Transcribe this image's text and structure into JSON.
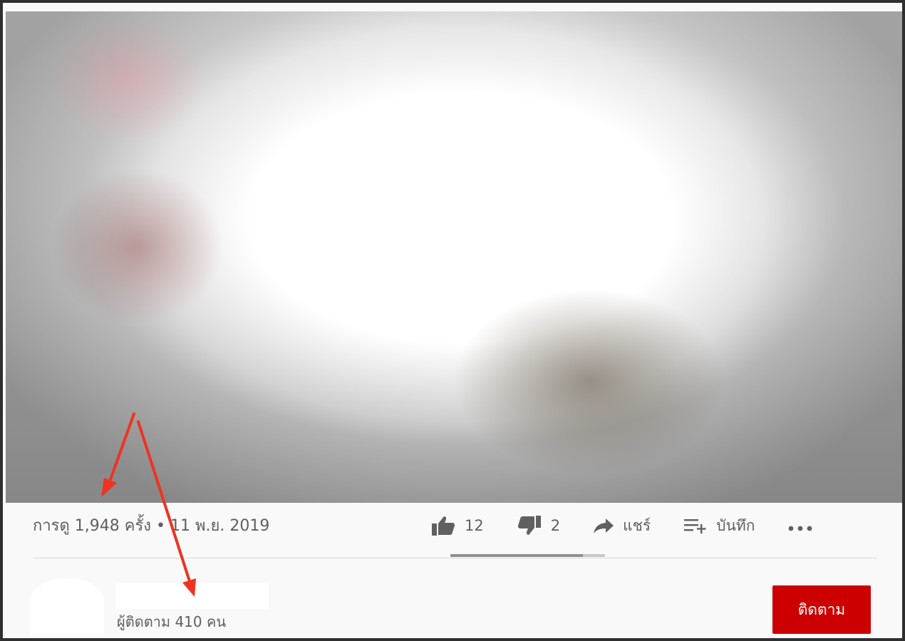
{
  "video": {
    "view_info": "การดู 1,948 ครั้ง • 11 พ.ย. 2019"
  },
  "actions": {
    "like_count": "12",
    "dislike_count": "2",
    "share_label": "แชร์",
    "save_label": "บันทึก",
    "like_ratio": 0.857
  },
  "channel": {
    "subscribers": "ผู้ติดตาม 410 คน",
    "subscribe_label": "ติดตาม"
  },
  "colors": {
    "accent_red": "#cc0000",
    "annotation_arrow": "#ee3322",
    "text_secondary": "#606060"
  },
  "icons": {
    "like": "thumbs-up-icon",
    "dislike": "thumbs-down-icon",
    "share": "share-arrow-icon",
    "save": "playlist-add-icon",
    "more": "more-horizontal-icon"
  }
}
